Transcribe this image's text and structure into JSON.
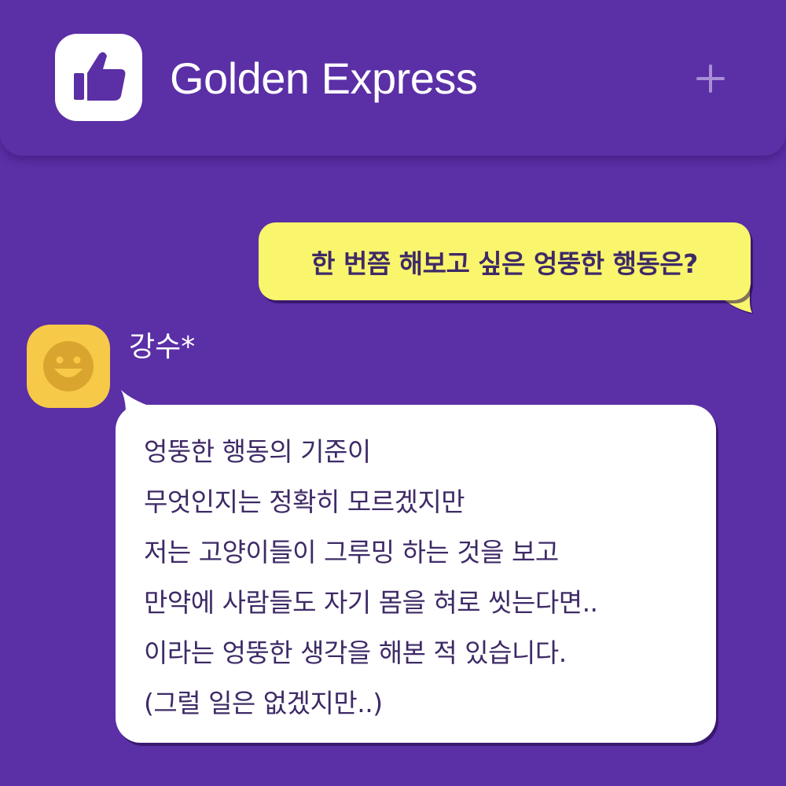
{
  "header": {
    "app_icon": "thumbs-up-icon",
    "title": "Golden Express",
    "add_icon": "plus-icon"
  },
  "question": {
    "text": "한 번쯤 해보고 싶은 엉뚱한 행동은?"
  },
  "reply": {
    "avatar_icon": "smiley-face-icon",
    "sender": "강수*",
    "lines": [
      "엉뚱한 행동의 기준이",
      "무엇인지는 정확히 모르겠지만",
      "저는 고양이들이 그루밍 하는 것을 보고",
      "만약에 사람들도 자기 몸을 혀로 씻는다면..",
      "이라는 엉뚱한 생각을 해본 적 있습니다.",
      "(그럴 일은 없겠지만..)"
    ]
  },
  "colors": {
    "background": "#5b2fa6",
    "question_bubble": "#f9f56d",
    "reply_bubble": "#ffffff",
    "avatar": "#f7c948",
    "text": "#3e2a66"
  }
}
